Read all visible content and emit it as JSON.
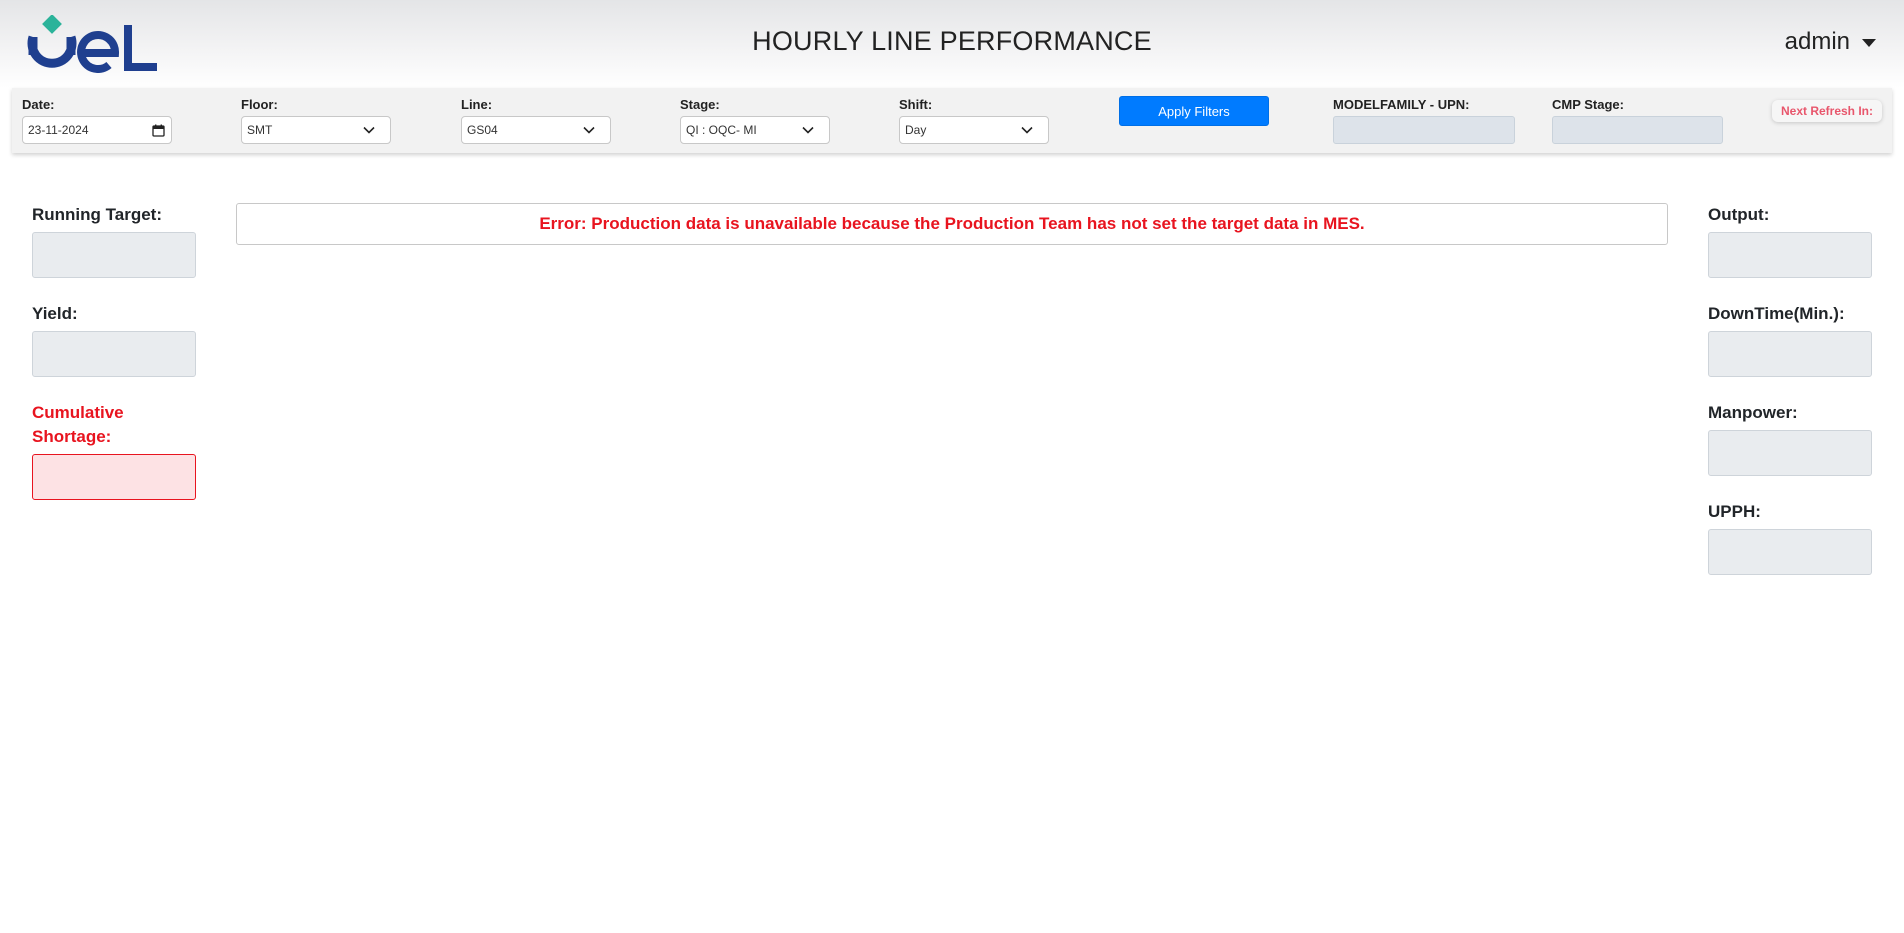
{
  "header": {
    "title": "HOURLY LINE PERFORMANCE",
    "user": "admin",
    "logo_name": "oel-logo",
    "logo_text": "OeL",
    "brand_color": "#1f3f8f",
    "logo_accent_color": "#2bb39a"
  },
  "filters": {
    "date": {
      "label": "Date:",
      "value": "23-11-2024",
      "icon": "calendar-icon"
    },
    "floor": {
      "label": "Floor:",
      "value": "SMT"
    },
    "line": {
      "label": "Line:",
      "value": "GS04"
    },
    "stage": {
      "label": "Stage:",
      "value": "QI : OQC- MI"
    },
    "shift": {
      "label": "Shift:",
      "value": "Day"
    },
    "apply_label": "Apply Filters",
    "modelfamily": {
      "label": "MODELFAMILY - UPN:",
      "value": ""
    },
    "cmp_stage": {
      "label": "CMP Stage:",
      "value": ""
    },
    "next_refresh_label": "Next Refresh In:"
  },
  "left_metrics": {
    "running_target": {
      "label": "Running Target:",
      "value": ""
    },
    "yield": {
      "label": "Yield:",
      "value": ""
    },
    "cumulative_shortage": {
      "label_line1": "Cumulative",
      "label_line2": "Shortage:",
      "value": ""
    }
  },
  "right_metrics": {
    "output": {
      "label": "Output:",
      "value": ""
    },
    "downtime": {
      "label": "DownTime(Min.):",
      "value": ""
    },
    "manpower": {
      "label": "Manpower:",
      "value": ""
    },
    "upph": {
      "label": "UPPH:",
      "value": ""
    }
  },
  "error_message": "Error: Production data is unavailable because the Production Team has not set the target data in MES.",
  "colors": {
    "primary_button": "#007bff",
    "error_text": "#e8141f",
    "refresh_text": "#e8566c"
  }
}
